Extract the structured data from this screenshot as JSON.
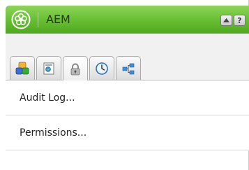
{
  "header": {
    "title": "AEM",
    "logo_icon": "aem-flower-logo-icon",
    "collapse_icon": "collapse-up-icon",
    "help_label": "?"
  },
  "tabs": [
    {
      "icon": "components-icon",
      "selected": false
    },
    {
      "icon": "page-icon",
      "selected": false
    },
    {
      "icon": "lock-icon",
      "selected": true
    },
    {
      "icon": "clock-icon",
      "selected": false
    },
    {
      "icon": "workflow-icon",
      "selected": false
    }
  ],
  "menu": {
    "items": [
      {
        "label": "Audit Log..."
      },
      {
        "label": "Permissions..."
      }
    ]
  },
  "colors": {
    "header_green": "#6cc236",
    "header_text": "#2a3a20"
  }
}
